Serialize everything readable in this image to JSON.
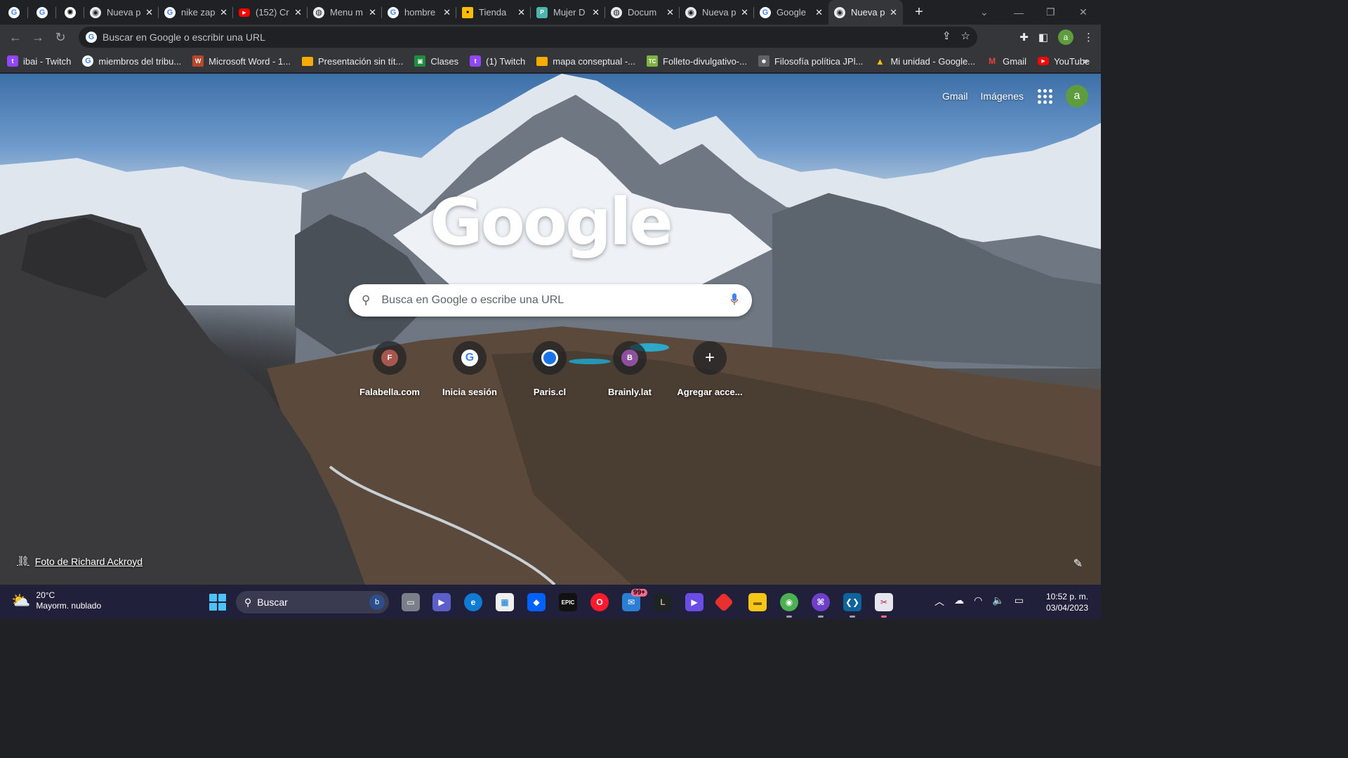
{
  "tabs": [
    {
      "title": "",
      "icon": "google",
      "pinned": true
    },
    {
      "title": "",
      "icon": "google",
      "pinned": true
    },
    {
      "title": "",
      "icon": "openai",
      "pinned": true
    },
    {
      "title": "Nueva p",
      "icon": "chrome"
    },
    {
      "title": "nike zap",
      "icon": "google"
    },
    {
      "title": "(152) Cr",
      "icon": "youtube"
    },
    {
      "title": "Menu m",
      "icon": "globe"
    },
    {
      "title": "hombre",
      "icon": "google"
    },
    {
      "title": "Tienda",
      "icon": "sq-yellow"
    },
    {
      "title": "Mujer D",
      "icon": "teal"
    },
    {
      "title": "Docum",
      "icon": "globe"
    },
    {
      "title": "Nueva p",
      "icon": "chrome"
    },
    {
      "title": "Google",
      "icon": "google"
    },
    {
      "title": "Nueva p",
      "icon": "chrome",
      "active": true
    }
  ],
  "omnibox": {
    "placeholder": "Buscar en Google o escribir una URL"
  },
  "profile_initial": "a",
  "bookmarks": [
    {
      "label": "ibai - Twitch",
      "icon": "twitch"
    },
    {
      "label": "miembros del tribu...",
      "icon": "google"
    },
    {
      "label": "Microsoft Word - 1...",
      "icon": "word"
    },
    {
      "label": "Presentación sin tít...",
      "icon": "folder"
    },
    {
      "label": "Clases",
      "icon": "class"
    },
    {
      "label": "(1) Twitch",
      "icon": "twitch"
    },
    {
      "label": "mapa conseptual -...",
      "icon": "folder"
    },
    {
      "label": "Folleto-divulgativo-...",
      "icon": "tc"
    },
    {
      "label": "Filosofía política JPl...",
      "icon": "person"
    },
    {
      "label": "Mi unidad - Google...",
      "icon": "drive"
    },
    {
      "label": "Gmail",
      "icon": "gmail"
    },
    {
      "label": "YouTube",
      "icon": "youtube"
    }
  ],
  "ntp": {
    "gmail_link": "Gmail",
    "images_link": "Imágenes",
    "logo": "Google",
    "search_placeholder": "Busca en Google o escribe una URL",
    "shortcuts": [
      {
        "label": "Falabella.com",
        "letter": "F",
        "color": "#a8574f"
      },
      {
        "label": "Inicia sesión",
        "letter": "G",
        "color": "#ffffff"
      },
      {
        "label": "Paris.cl",
        "letter": "",
        "color": "#1a73e8"
      },
      {
        "label": "Brainly.lat",
        "letter": "B",
        "color": "#8e4f9c"
      },
      {
        "label": "Agregar acce...",
        "letter": "+",
        "color": ""
      }
    ],
    "attribution": "Foto de Richard Ackroyd"
  },
  "taskbar": {
    "temperature": "20°C",
    "weather": "Mayorm. nublado",
    "search_label": "Buscar",
    "mail_badge": "99+",
    "time": "10:52 p. m.",
    "date": "03/04/2023"
  },
  "colors": {
    "chrome_dark": "#202124",
    "toolbar": "#35363a",
    "accent_green": "#5e9c3e",
    "taskbar": "#20203a"
  }
}
